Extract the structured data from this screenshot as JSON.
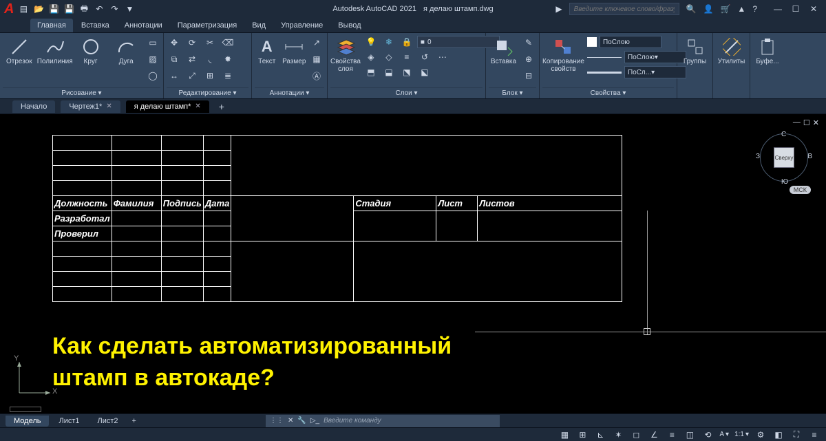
{
  "app": {
    "title": "Autodesk AutoCAD 2021",
    "filename": "я делаю штамп.dwg",
    "search_placeholder": "Введите ключевое слово/фразу"
  },
  "ribbon_tabs": [
    "Главная",
    "Вставка",
    "Аннотации",
    "Параметризация",
    "Вид",
    "Управление",
    "Вывод"
  ],
  "ribbon_active": "Главная",
  "panels": {
    "draw": {
      "title": "Рисование ▾",
      "line": "Отрезок",
      "polyline": "Полилиния",
      "circle": "Круг",
      "arc": "Дуга"
    },
    "edit": {
      "title": "Редактирование ▾"
    },
    "anno": {
      "title": "Аннотации ▾",
      "text": "Текст",
      "dim": "Размер"
    },
    "layers": {
      "title": "Слои ▾",
      "props": "Свойства слоя",
      "current": "0"
    },
    "block": {
      "title": "Блок ▾",
      "insert": "Вставка"
    },
    "props": {
      "title": "Свойства ▾",
      "match": "Копирование свойств",
      "bylayer": "ПоСлою",
      "bylayer2": "ПоСлою▾",
      "bylayer3": "ПоСл...▾"
    },
    "groups": {
      "title": "Группы"
    },
    "utils": {
      "title": "Утилиты"
    },
    "clip": {
      "title": "Буфе..."
    }
  },
  "file_tabs": [
    {
      "label": "Начало",
      "close": false,
      "active": false
    },
    {
      "label": "Чертеж1*",
      "close": true,
      "active": false
    },
    {
      "label": "я делаю штамп*",
      "close": true,
      "active": true
    }
  ],
  "stamp": {
    "headers": {
      "pos": "Должность",
      "name": "Фамилия",
      "sign": "Подпись",
      "date": "Дата"
    },
    "rows": [
      "Разработал",
      "Проверил"
    ],
    "right": {
      "stage": "Стадия",
      "sheet": "Лист",
      "sheets": "Листов"
    }
  },
  "headline": {
    "l1": "Как сделать автоматизированный",
    "l2": "штамп в автокаде?"
  },
  "viewcube": {
    "top": "Сверху",
    "n": "С",
    "s": "Ю",
    "w": "З",
    "e": "В"
  },
  "wcs_badge": "МСК",
  "ucs": {
    "x": "X",
    "y": "Y"
  },
  "layout_tabs": [
    "Модель",
    "Лист1",
    "Лист2"
  ],
  "layout_active": "Модель",
  "cmd_placeholder": "Введите команду",
  "status": {
    "scale": "1:1",
    "annoscale": "A"
  }
}
